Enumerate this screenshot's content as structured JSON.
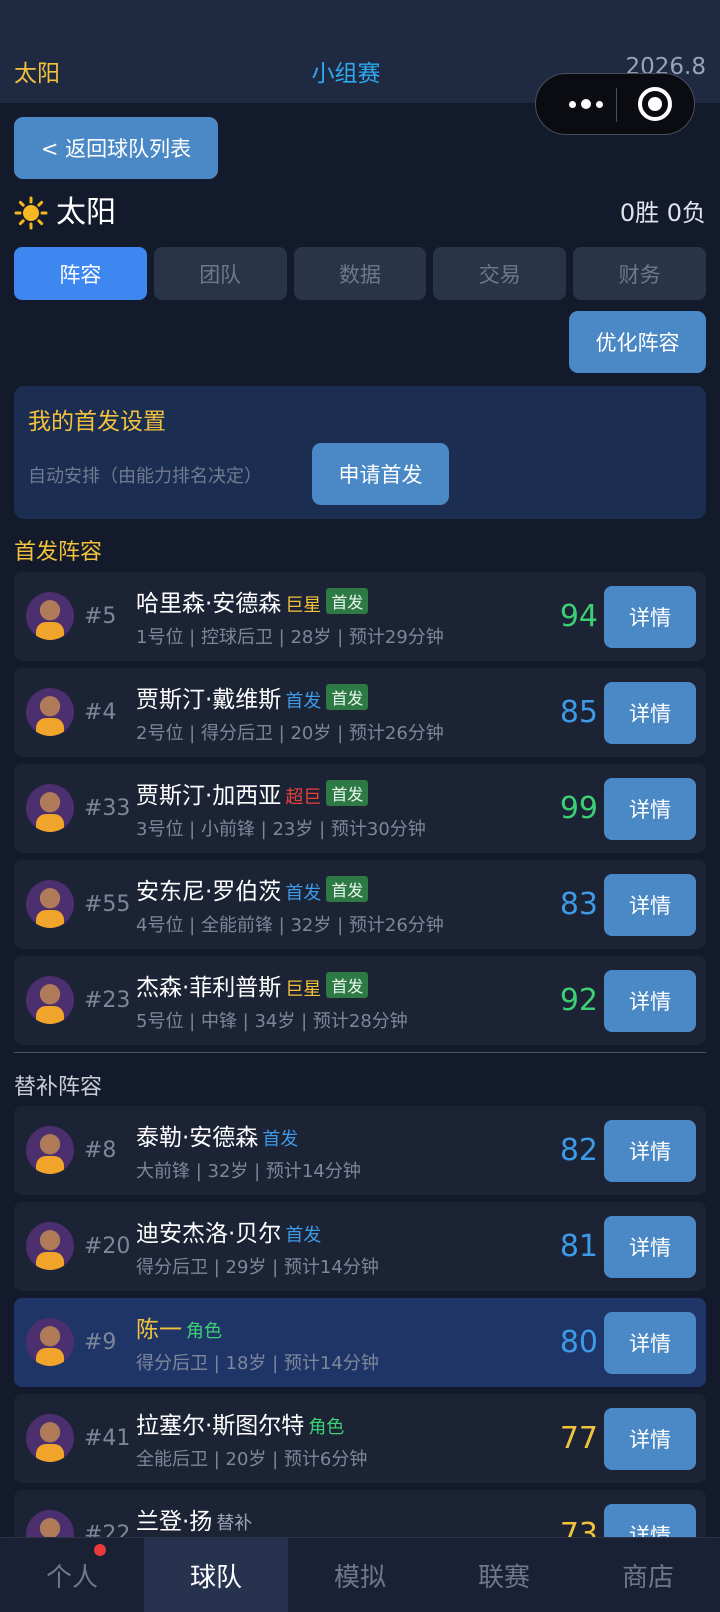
{
  "header": {
    "team": "太阳",
    "stage": "小组赛",
    "date": "2026.8"
  },
  "back_button": "< 返回球队列表",
  "team": {
    "name": "太阳",
    "record": "0胜 0负"
  },
  "tabs": [
    {
      "label": "阵容",
      "active": true
    },
    {
      "label": "团队",
      "active": false
    },
    {
      "label": "数据",
      "active": false
    },
    {
      "label": "交易",
      "active": false
    },
    {
      "label": "财务",
      "active": false
    }
  ],
  "optimize_button": "优化阵容",
  "starter_setting": {
    "title": "我的首发设置",
    "description": "自动安排（由能力排名决定）",
    "button": "申请首发"
  },
  "sections": {
    "starters": "首发阵容",
    "bench": "替补阵容"
  },
  "detail_label": "详情",
  "starters": [
    {
      "number": "#5",
      "name": "哈里森·安德森",
      "role": "巨星",
      "badge": "首发",
      "info": "1号位 | 控球后卫 | 28岁 | 预计29分钟",
      "rating": "94"
    },
    {
      "number": "#4",
      "name": "贾斯汀·戴维斯",
      "role": "首发",
      "badge": "首发",
      "info": "2号位 | 得分后卫 | 20岁 | 预计26分钟",
      "rating": "85"
    },
    {
      "number": "#33",
      "name": "贾斯汀·加西亚",
      "role": "超巨",
      "badge": "首发",
      "info": "3号位 | 小前锋 | 23岁 | 预计30分钟",
      "rating": "99"
    },
    {
      "number": "#55",
      "name": "安东尼·罗伯茨",
      "role": "首发",
      "badge": "首发",
      "info": "4号位 | 全能前锋 | 32岁 | 预计26分钟",
      "rating": "83"
    },
    {
      "number": "#23",
      "name": "杰森·菲利普斯",
      "role": "巨星",
      "badge": "首发",
      "info": "5号位 | 中锋 | 34岁 | 预计28分钟",
      "rating": "92"
    }
  ],
  "bench": [
    {
      "number": "#8",
      "name": "泰勒·安德森",
      "role": "首发",
      "info": "大前锋 | 32岁 | 预计14分钟",
      "rating": "82"
    },
    {
      "number": "#20",
      "name": "迪安杰洛·贝尔",
      "role": "首发",
      "info": "得分后卫 | 29岁 | 预计14分钟",
      "rating": "81"
    },
    {
      "number": "#9",
      "name": "陈一",
      "role": "角色",
      "info": "得分后卫 | 18岁 | 预计14分钟",
      "rating": "80"
    },
    {
      "number": "#41",
      "name": "拉塞尔·斯图尔特",
      "role": "角色",
      "info": "全能后卫 | 20岁 | 预计6分钟",
      "rating": "77"
    },
    {
      "number": "#22",
      "name": "兰登·扬",
      "role": "替补",
      "info": "",
      "rating": "73"
    }
  ],
  "nav": [
    {
      "label": "个人",
      "active": false,
      "dot": true
    },
    {
      "label": "球队",
      "active": true,
      "dot": false
    },
    {
      "label": "模拟",
      "active": false,
      "dot": false
    },
    {
      "label": "联赛",
      "active": false,
      "dot": false
    },
    {
      "label": "商店",
      "active": false,
      "dot": false
    }
  ]
}
